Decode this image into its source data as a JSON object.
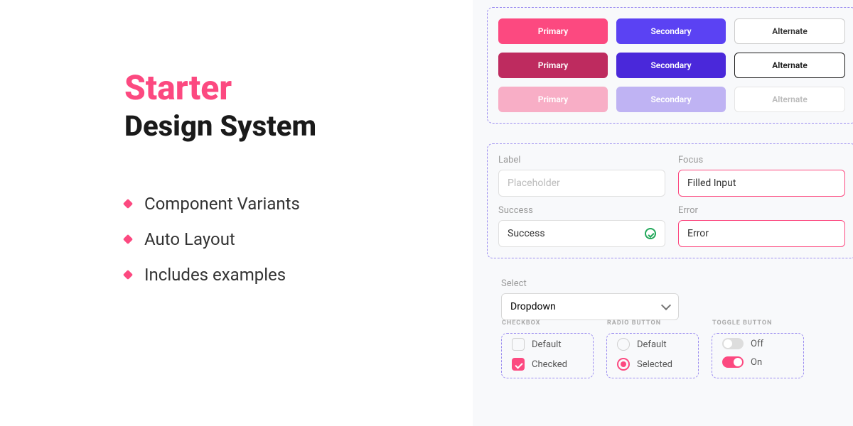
{
  "title": {
    "line1": "Starter",
    "line2": "Design System"
  },
  "features": [
    "Component Variants",
    "Auto Layout",
    "Includes examples"
  ],
  "buttons": {
    "primary": "Primary",
    "secondary": "Secondary",
    "alternate": "Alternate"
  },
  "inputs": {
    "label": {
      "label": "Label",
      "placeholder": "Placeholder"
    },
    "focus": {
      "label": "Focus",
      "value": "Filled Input"
    },
    "success": {
      "label": "Success",
      "value": "Success"
    },
    "error": {
      "label": "Error",
      "value": "Error"
    }
  },
  "select": {
    "label": "Select",
    "value": "Dropdown"
  },
  "checkbox": {
    "header": "CHECKBOX",
    "default": "Default",
    "checked": "Checked"
  },
  "radio": {
    "header": "RADIO BUTTON",
    "default": "Default",
    "selected": "Selected"
  },
  "toggle": {
    "header": "TOGGLE BUTTON",
    "off": "Off",
    "on": "On"
  },
  "colors": {
    "primary": "#fc4980",
    "secondary": "#5b42f3"
  }
}
